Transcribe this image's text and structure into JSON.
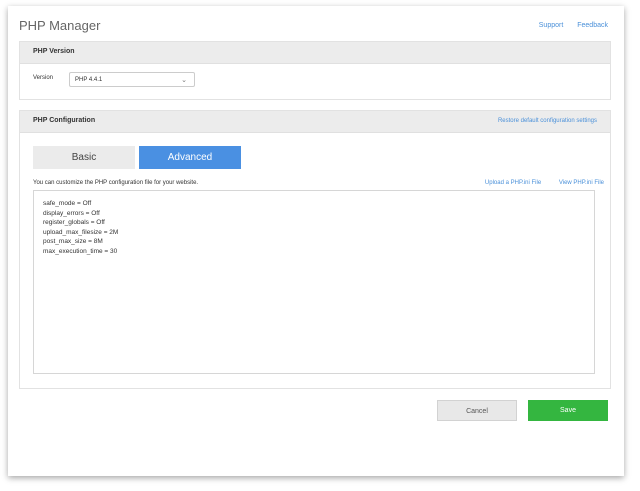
{
  "app": {
    "title": "PHP Manager"
  },
  "top_links": {
    "support": "Support",
    "feedback": "Feedback"
  },
  "version_panel": {
    "title": "PHP Version",
    "version_label": "Version",
    "selected_version": "PHP 4.4.1"
  },
  "config_panel": {
    "title": "PHP Configuration",
    "restore_link": "Restore default configuration settings",
    "tabs": [
      {
        "label": "Basic",
        "active": false
      },
      {
        "label": "Advanced",
        "active": true
      }
    ],
    "description": "You can customize the PHP configuration file for your website.",
    "upload_link": "Upload a PHP.ini File",
    "view_link": "View PHP.ini File",
    "editor_lines": [
      "safe_mode = Off",
      "display_errors = Off",
      "register_globals = Off",
      "upload_max_filesize = 2M",
      "post_max_size = 8M",
      "max_execution_time = 30"
    ]
  },
  "actions": {
    "cancel": "Cancel",
    "save": "Save"
  },
  "colors": {
    "accent": "#4a90e2",
    "save": "#34b640",
    "link": "#4a90d9"
  },
  "icons": {
    "select_chevron": "chevron-down-icon"
  }
}
